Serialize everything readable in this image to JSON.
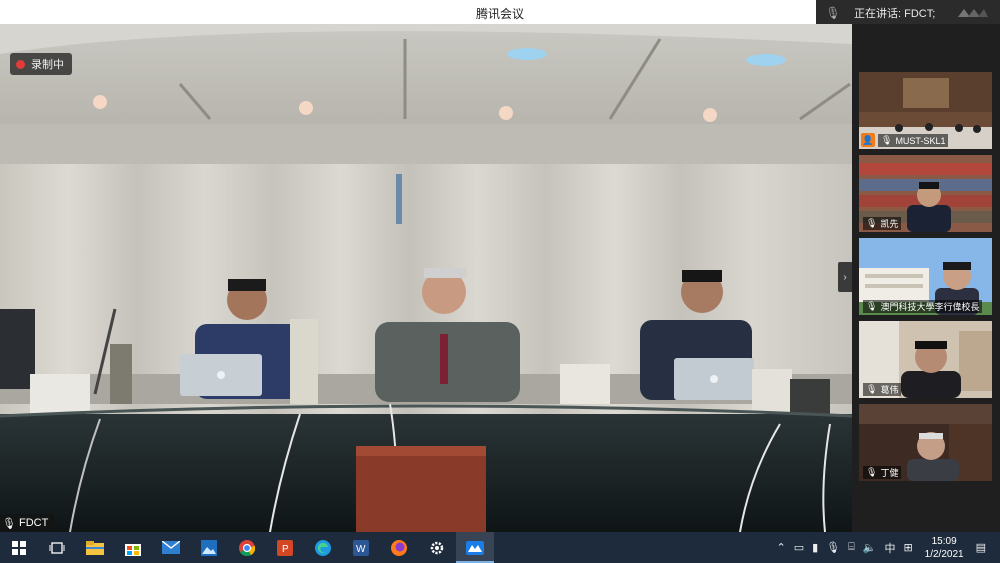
{
  "window": {
    "title": "腾讯会议",
    "speaking_prefix": "正在讲话:",
    "speaking_name": "FDCT;"
  },
  "recording": {
    "label": "录制中"
  },
  "main_video": {
    "speaker": "FDCT"
  },
  "participants": [
    {
      "name": "MUST-SKL1",
      "icon": "mic-icon",
      "host": true
    },
    {
      "name": "凯先",
      "icon": "mic-icon",
      "host": false
    },
    {
      "name": "澳門科技大學李行偉校長",
      "icon": "mic-icon",
      "host": false
    },
    {
      "name": "葛伟",
      "icon": "mic-icon",
      "host": false
    },
    {
      "name": "丁健",
      "icon": "mic-icon",
      "host": false
    }
  ],
  "taskbar": {
    "apps": [
      "windows-start-icon",
      "task-view-icon",
      "file-explorer-icon",
      "store-icon",
      "mail-icon",
      "photos-icon",
      "chrome-icon",
      "powerpoint-icon",
      "edge-icon",
      "word-icon",
      "firefox-icon",
      "settings-icon",
      "tencent-meeting-icon"
    ],
    "tray": {
      "ime": "中",
      "time": "15:09",
      "date": "1/2/2021"
    }
  },
  "colors": {
    "accent": "#f07c1b",
    "taskbar": "#1d2b3c",
    "record": "#e23b3b"
  }
}
